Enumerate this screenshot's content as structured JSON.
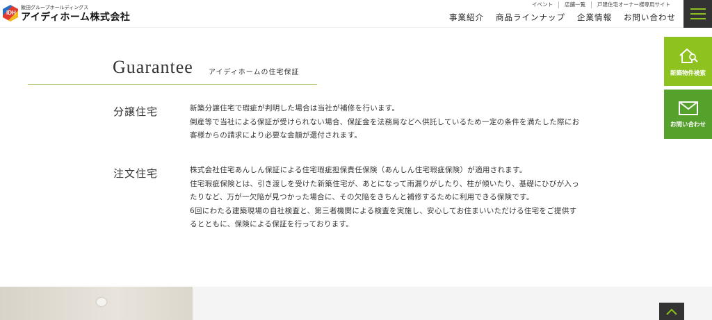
{
  "header": {
    "logo_sub": "飯田グループホールディングス",
    "logo_main": "アイディホーム株式会社",
    "logo_mark": "IDH",
    "util_links": [
      "イベント",
      "店舗一覧",
      "戸建住宅オーナー様専用サイト"
    ],
    "nav": [
      "事業紹介",
      "商品ラインナップ",
      "企業情報",
      "お問い合わせ"
    ]
  },
  "side": {
    "search_label": "新築物件検索",
    "contact_label": "お問い合わせ"
  },
  "section": {
    "title_en": "Guarantee",
    "title_ja": "アイディホームの住宅保証",
    "rows": [
      {
        "heading": "分譲住宅",
        "lines": [
          "新築分譲住宅で瑕疵が判明した場合は当社が補修を行います。",
          "倒産等で当社による保証が受けられない場合、保証金を法務局などへ供託しているため一定の条件を満たした際にお",
          "客様からの請求により必要な金額が還付されます。"
        ]
      },
      {
        "heading": "注文住宅",
        "lines": [
          "株式会社住宅あんしん保証による住宅瑕疵担保責任保険（あんしん住宅瑕疵保険）が適用されます。",
          "住宅瑕疵保険とは、引き渡しを受けた新築住宅が、あとになって雨漏りがしたり、柱が傾いたり、基礎にひびが入っ",
          "たりなど、万が一欠陥が見つかった場合に、その欠陥をきちんと補修するために利用できる保険です。",
          "6回にわたる建築現場の自社検査と、第三者機関による検査を実施し、安心してお住まいいただける住宅をご提供す",
          "るとともに、保険による保証を行っております。"
        ]
      }
    ]
  },
  "colors": {
    "accent": "#8dc21f",
    "accent_dark": "#56a12c",
    "dark": "#333333"
  },
  "icons": [
    "house-search-icon",
    "mail-icon",
    "hamburger-icon",
    "chevron-up-icon"
  ]
}
